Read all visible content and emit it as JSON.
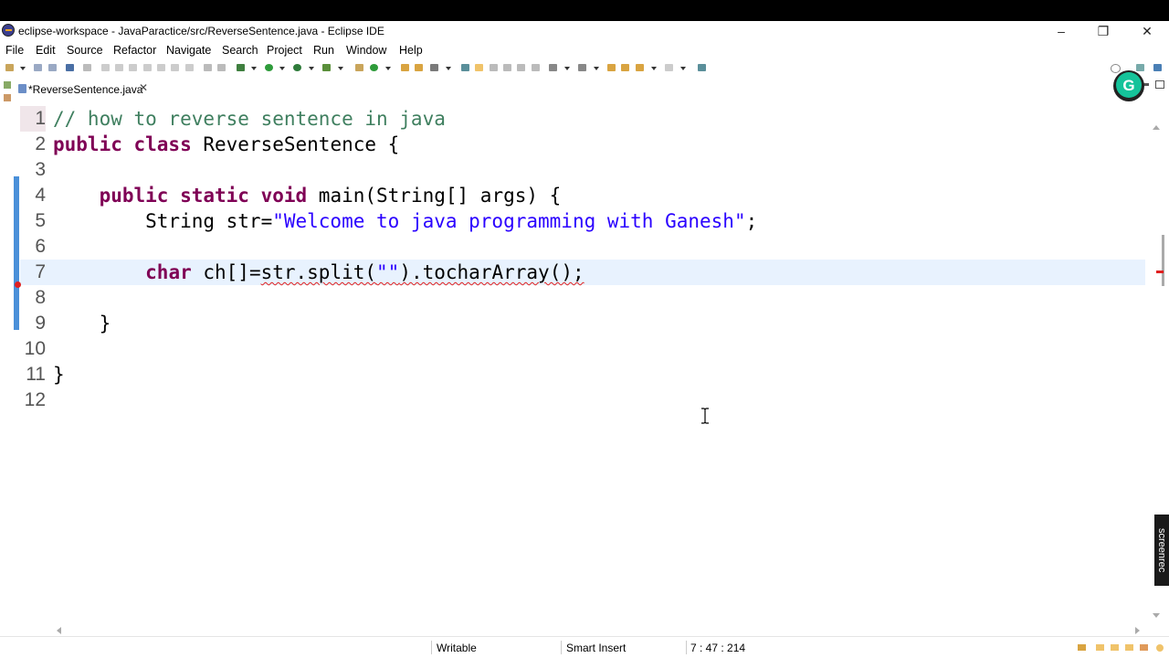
{
  "window": {
    "title": "eclipse-workspace - JavaParactice/src/ReverseSentence.java - Eclipse IDE",
    "minimize": "–",
    "restore": "❐",
    "close": "✕"
  },
  "menu": [
    "File",
    "Edit",
    "Source",
    "Refactor",
    "Navigate",
    "Search",
    "Project",
    "Run",
    "Window",
    "Help"
  ],
  "tab": {
    "label": "*ReverseSentence.java",
    "close": "✕"
  },
  "editor": {
    "line_numbers": [
      "1",
      "2",
      "3",
      "4",
      "5",
      "6",
      "7",
      "8",
      "9",
      "10",
      "11",
      "12"
    ],
    "lines": [
      [
        {
          "t": "// how to reverse sentence in java",
          "c": "cm"
        }
      ],
      [
        {
          "t": "public class ",
          "c": "kw"
        },
        {
          "t": "ReverseSentence {",
          "c": "plain"
        }
      ],
      [],
      [
        {
          "t": "    ",
          "c": "plain"
        },
        {
          "t": "public static void ",
          "c": "kw"
        },
        {
          "t": "main(String[] args) {",
          "c": "plain"
        }
      ],
      [
        {
          "t": "        String str=",
          "c": "plain"
        },
        {
          "t": "\"Welcome to java programming with Ganesh\"",
          "c": "st"
        },
        {
          "t": ";",
          "c": "plain"
        }
      ],
      [],
      [
        {
          "t": "        ",
          "c": "plain"
        },
        {
          "t": "char ",
          "c": "kw"
        },
        {
          "t": "ch[]=",
          "c": "plain"
        },
        {
          "t": "str.split(",
          "c": "plain err"
        },
        {
          "t": "\"\"",
          "c": "st err"
        },
        {
          "t": ").tocharArray();",
          "c": "plain err"
        }
      ],
      [],
      [
        {
          "t": "    }",
          "c": "plain"
        }
      ],
      [],
      [
        {
          "t": "}",
          "c": "plain"
        }
      ],
      []
    ],
    "current_line": 7,
    "error_line": 7
  },
  "status": {
    "writable": "Writable",
    "insert_mode": "Smart Insert",
    "position": "7 : 47 : 214"
  },
  "overlay": {
    "grammarly_letter": "G",
    "screenrec_label": "screenrec"
  },
  "colors": {
    "keyword": "#7f0055",
    "comment": "#3f7f5f",
    "string": "#2a00ff",
    "current_line_bg": "#e8f2fe",
    "change_bar": "#4a90d9",
    "grammarly": "#15c39a"
  }
}
